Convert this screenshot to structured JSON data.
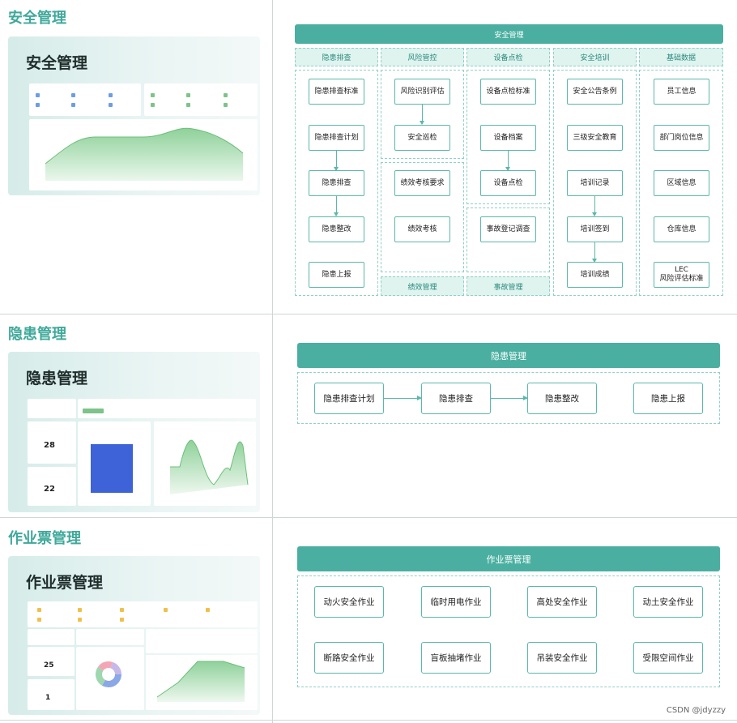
{
  "watermark": "CSDN @jdyzzy",
  "colors": {
    "teal": "#4aafa0",
    "title": "#3fa99a",
    "light": "#dff3ef"
  },
  "sections": [
    {
      "title": "安全管理",
      "card_title": "安全管理",
      "diagram": {
        "header": "安全管理",
        "columns": [
          {
            "head": "隐患排查",
            "items": [
              "隐患排查标准",
              "隐患排查计划",
              "隐患排查",
              "隐患整改",
              "隐患上报"
            ]
          },
          {
            "head": "风险管控",
            "items": [
              "风险识别评估",
              "安全巡检"
            ],
            "items2": [
              "绩效考核要求",
              "绩效考核"
            ],
            "foot": "绩效管理"
          },
          {
            "head": "设备点检",
            "items": [
              "设备点检标准",
              "设备档案",
              "设备点检"
            ],
            "items2": [
              "事故登记调查"
            ],
            "foot": "事故管理"
          },
          {
            "head": "安全培训",
            "items": [
              "安全公告条例",
              "三级安全教育",
              "培训记录",
              "培训签到",
              "培训成绩"
            ]
          },
          {
            "head": "基础数据",
            "items": [
              "员工信息",
              "部门岗位信息",
              "区域信息",
              "仓库信息",
              "LEC\n风险评估标准"
            ]
          }
        ]
      }
    },
    {
      "title": "隐患管理",
      "card_title": "隐患管理",
      "stats": [
        "28",
        "22"
      ],
      "diagram": {
        "header": "隐患管理",
        "items": [
          "隐患排查计划",
          "隐患排查",
          "隐患整改",
          "隐患上报"
        ]
      }
    },
    {
      "title": "作业票管理",
      "card_title": "作业票管理",
      "stats": [
        "25",
        "1"
      ],
      "diagram": {
        "header": "作业票管理",
        "row1": [
          "动火安全作业",
          "临时用电作业",
          "高处安全作业",
          "动土安全作业"
        ],
        "row2": [
          "断路安全作业",
          "盲板抽堵作业",
          "吊装安全作业",
          "受限空间作业"
        ]
      }
    }
  ]
}
